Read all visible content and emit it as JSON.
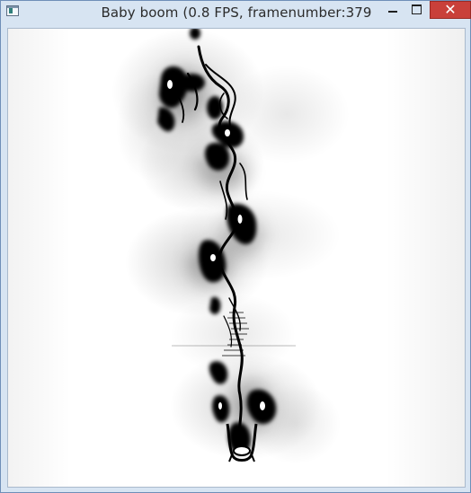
{
  "window": {
    "title": "Baby boom (0.8 FPS, framenumber:379",
    "icon": "app-window-icon",
    "controls": {
      "minimize_icon": "minimize-icon",
      "maximize_icon": "maximize-icon",
      "close_icon": "close-icon",
      "close_glyph": "✕",
      "close_color": "#c9403a"
    },
    "frame_color": "#d7e4f2"
  },
  "viewport": {
    "content": "fluid-simulation-render",
    "background": "#ffffff",
    "ink": "#000000"
  }
}
